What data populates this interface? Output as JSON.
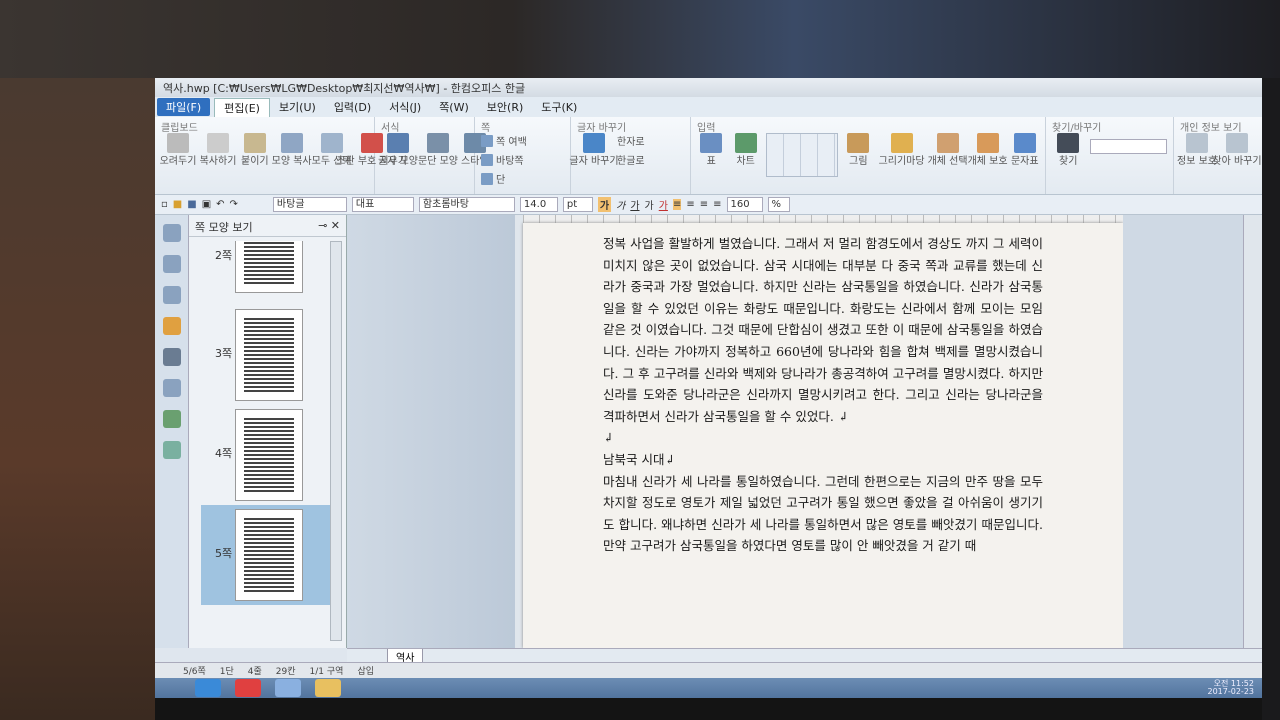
{
  "window": {
    "title": "역사.hwp [C:₩Users₩LG₩Desktop₩최지선₩역사₩] - 한컴오피스 한글"
  },
  "menu": [
    "파일(F)",
    "편집(E)",
    "보기(U)",
    "입력(D)",
    "서식(J)",
    "쪽(W)",
    "보안(R)",
    "도구(K)"
  ],
  "ribbon": {
    "clipboard": {
      "title": "클립보드",
      "buttons": [
        "오려두기",
        "복사하기",
        "붙이기",
        "모양 복사",
        "모두 선택",
        "조판 부호 지우기"
      ]
    },
    "format": {
      "title": "서식",
      "buttons": [
        "글자 모양",
        "문단 모양",
        "스타일"
      ]
    },
    "page": {
      "title": "쪽",
      "items": [
        "쪽 여백",
        "바탕쪽",
        "단"
      ]
    },
    "char": {
      "title": "글자 바꾸기",
      "items": [
        "글자 바꾸기",
        "한자로",
        "한글로"
      ]
    },
    "insert": {
      "title": "입력",
      "buttons": [
        "표",
        "차트",
        "그림",
        "그리기마당",
        "개체 선택",
        "개체 보호",
        "문자표"
      ]
    },
    "find": {
      "title": "찾기/바꾸기",
      "buttons": [
        "찾기"
      ]
    },
    "info": {
      "title": "개인 정보 보기",
      "buttons": [
        "정보 보호",
        "찾아 바꾸기"
      ]
    }
  },
  "toolbar": {
    "style": "바탕글",
    "lang": "대표",
    "font": "함초롬바탕",
    "size": "14.0",
    "unit": "pt",
    "zoom": "160",
    "zoom_unit": "%"
  },
  "pane": {
    "title": "쪽 모양 보기",
    "pages": [
      "2쪽",
      "3쪽",
      "4쪽",
      "5쪽"
    ]
  },
  "document": {
    "paragraphs": [
      "정복 사업을 활발하게 벌였습니다. 그래서 저 멀리 함경도에서 경상도 까지 그 세력이 미치지 않은 곳이 없었습니다. 삼국 시대에는 대부분 다 중국 쪽과 교류를 했는데 신라가 중국과 가장 멀었습니다. 하지만 신라는 삼국통일을 하였습니다. 신라가 삼국통일을 할 수 있었던 이유는 화랑도 때문입니다. 화랑도는 신라에서 함께 모이는 모임 같은 것 이였습니다. 그것 때문에 단합심이 생겼고 또한 이 때문에 삼국통일을 하였습니다. 신라는 가야까지 정복하고 660년에 당나라와 힘을 합쳐 백제를 멸망시켰습니다. 그 후 고구려를 신라와 백제와 당나라가 총공격하여 고구려를 멸망시켰다. 하지만 신라를 도와준 당나라군은 신라까지 멸망시키려고 한다. 그리고 신라는 당나라군을 격파하면서 신라가 삼국통일을 할 수 있었다. ↲",
      "↲",
      "남북국 시대↲",
      "마침내 신라가 세 나라를 통일하였습니다. 그런데 한편으로는 지금의 만주 땅을 모두 차지할 정도로 영토가 제일 넓었던 고구려가 통일 했으면 좋았을 걸 아쉬움이 생기기도 합니다. 왜냐하면 신라가 세 나라를 통일하면서 많은 영토를 빼앗겼기 때문입니다. 만약 고구려가 삼국통일을 하였다면 영토를 많이 안 빼앗겼을 거 같기 때"
    ]
  },
  "tab": "역사",
  "status": [
    "5/6쪽",
    "1단",
    "4줄",
    "29칸",
    "1/1 구역",
    "삽입"
  ],
  "tray": {
    "time": "오전 11:52",
    "date": "2017-02-23"
  }
}
